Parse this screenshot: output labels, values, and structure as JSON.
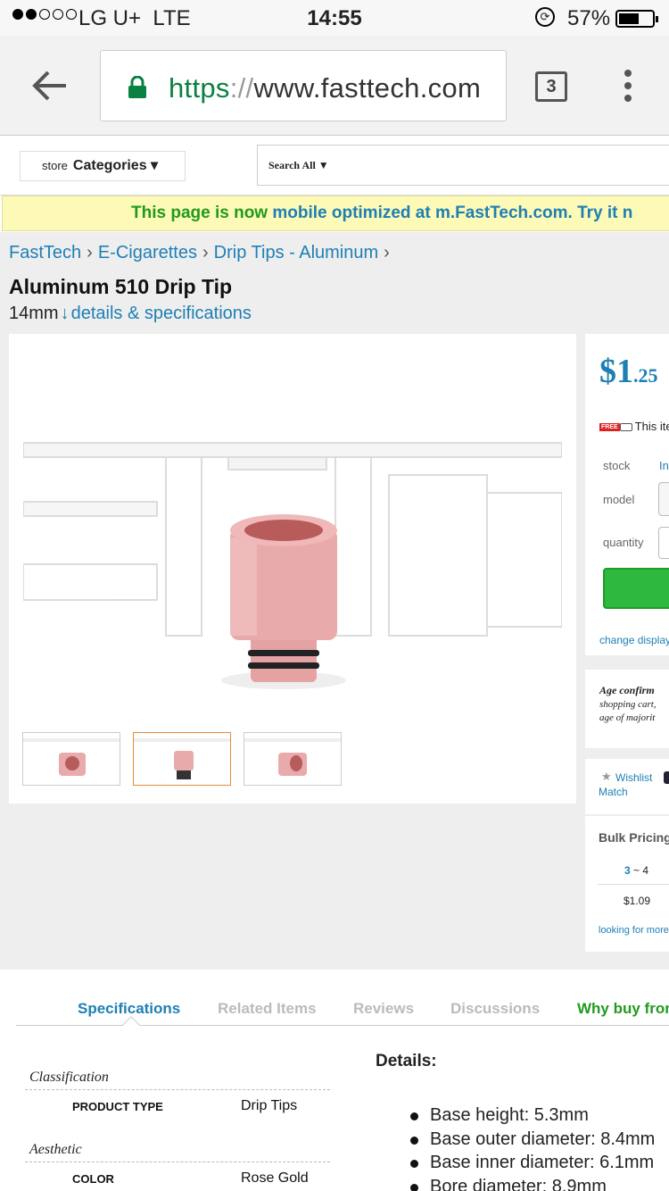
{
  "status": {
    "carrier": "LG U+",
    "network": "LTE",
    "time": "14:55",
    "battery_pct": "57%",
    "battery_level": 0.57
  },
  "browser": {
    "url_scheme": "https",
    "url_sep": "://",
    "url_host": "www.fasttech.com",
    "tab_count": "3"
  },
  "header": {
    "store_label": "store",
    "categories_label": "Categories ▾",
    "search_label": "Search All ▼"
  },
  "notice": {
    "part1": "This page is now ",
    "part2": "mobile optimized at m.FastTech.com. Try it n"
  },
  "breadcrumb": [
    "FastTech",
    "E-Cigarettes",
    "Drip Tips - Aluminum"
  ],
  "breadcrumb_sep": "›",
  "product": {
    "title": "Aluminum 510 Drip Tip",
    "size": "14mm",
    "details_link": "details & specifications",
    "color": "#e7a9a8"
  },
  "purchase": {
    "price_main": "$1",
    "price_cents": ".25",
    "free_badge": "FREE",
    "free_text": "This item",
    "stock_label": "stock",
    "stock_value": "In",
    "model_label": "model",
    "quantity_label": "quantity",
    "change_display": "change display"
  },
  "age": {
    "title": "Age confirm",
    "line1": "shopping cart,",
    "line2": "age of majorit"
  },
  "wishlist": {
    "wishlist": "Wishlist",
    "match": "Match"
  },
  "bulk": {
    "title": "Bulk Pricing",
    "range_from": "3",
    "range_to": "~ 4",
    "price": "$1.09",
    "more": "looking for more"
  },
  "tabs": {
    "specifications": "Specifications",
    "related": "Related Items",
    "reviews": "Reviews",
    "discussions": "Discussions",
    "why": "Why buy from"
  },
  "specs": {
    "classification": "Classification",
    "product_type_key": "PRODUCT TYPE",
    "product_type_val": "Drip Tips",
    "aesthetic": "Aesthetic",
    "color_key": "COLOR",
    "color_val": "Rose Gold"
  },
  "details": {
    "title": "Details:",
    "items": [
      "Base height: 5.3mm",
      "Base outer diameter: 8.4mm",
      "Base inner diameter: 6.1mm",
      "Bore diameter: 8.9mm"
    ]
  },
  "colors": {
    "link_blue": "#1e7fb4",
    "green": "#219a1e",
    "notice_bg": "#fdf9b7",
    "add_button": "#2fb83e"
  }
}
